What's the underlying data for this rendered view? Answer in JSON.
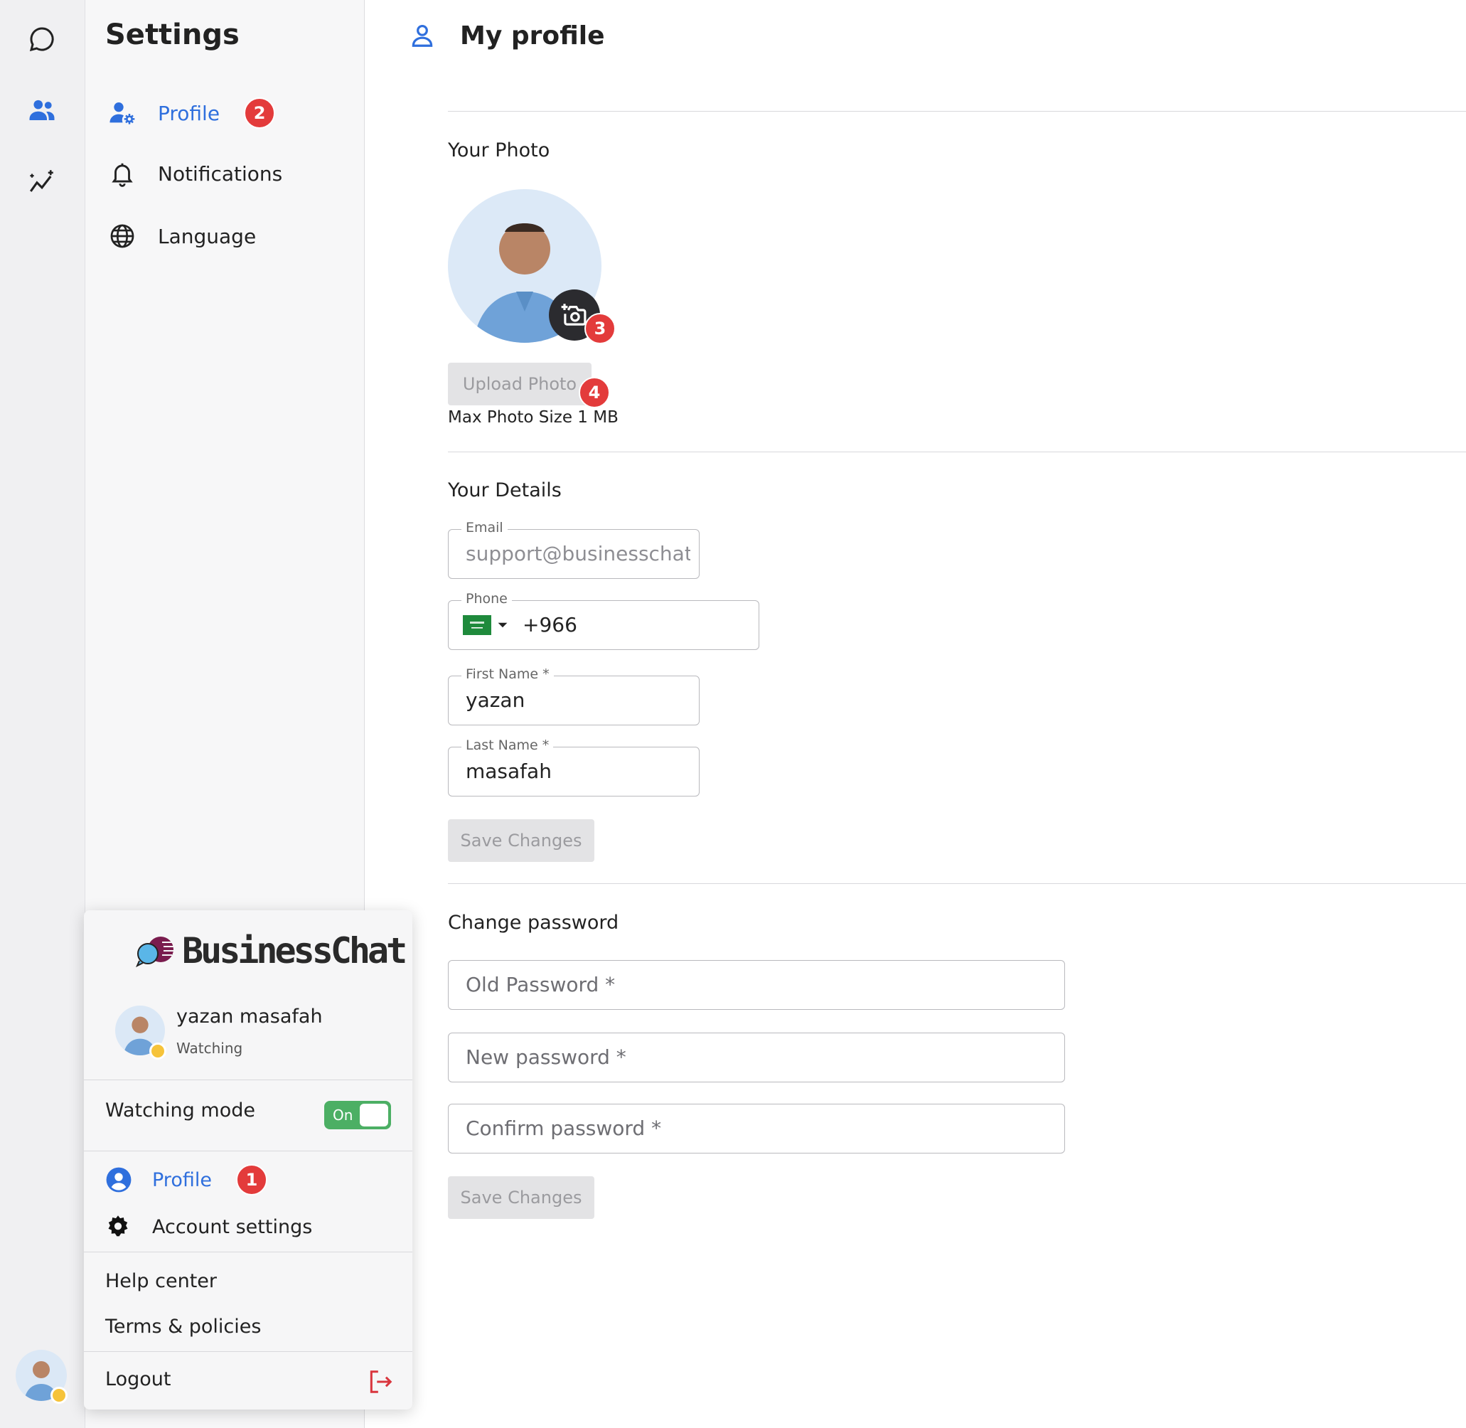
{
  "sidebar": {
    "title": "Settings",
    "items": [
      {
        "label": "Profile",
        "icon": "user-gear-icon",
        "badge": "2"
      },
      {
        "label": "Notifications",
        "icon": "bell-icon"
      },
      {
        "label": "Language",
        "icon": "globe-icon"
      }
    ]
  },
  "main": {
    "title": "My profile",
    "photo_section": {
      "title": "Your Photo",
      "camera_badge": "3",
      "upload_button": "Upload Photo",
      "upload_badge": "4",
      "note": "Max Photo Size 1 MB"
    },
    "details": {
      "title": "Your Details",
      "email_label": "Email",
      "email_value": "support@businesschat.ic",
      "phone_label": "Phone",
      "phone_value": "+966",
      "first_name_label": "First Name *",
      "first_name_value": "yazan",
      "last_name_label": "Last Name *",
      "last_name_value": "masafah",
      "save_button": "Save Changes"
    },
    "password": {
      "title": "Change password",
      "old_placeholder": "Old Password *",
      "new_placeholder": "New password *",
      "confirm_placeholder": "Confirm password *",
      "save_button": "Save Changes"
    }
  },
  "popover": {
    "logo_text": "BusinessChat",
    "user_name": "yazan masafah",
    "user_status": "Watching",
    "watching_mode_label": "Watching mode",
    "toggle_label": "On",
    "profile_label": "Profile",
    "profile_badge": "1",
    "account_settings_label": "Account settings",
    "help_center_label": "Help center",
    "terms_label": "Terms & policies",
    "logout_label": "Logout"
  },
  "colors": {
    "accent": "#2f6fdd",
    "badge": "#e33b3b",
    "toggle_on": "#4caf64",
    "logout_icon": "#d9363e"
  }
}
